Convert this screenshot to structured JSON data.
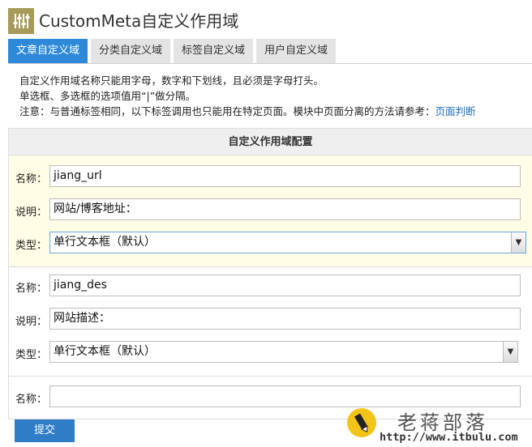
{
  "header": {
    "title": "CustomMeta自定义作用域",
    "logo_icon": "meta-settings-icon",
    "logo_color": "#a59a5a"
  },
  "tabs": [
    {
      "label": "文章自定义域",
      "active": true
    },
    {
      "label": "分类自定义域",
      "active": false
    },
    {
      "label": "标签自定义域",
      "active": false
    },
    {
      "label": "用户自定义域",
      "active": false
    }
  ],
  "notes": {
    "line1": "自定义作用域名称只能用字母，数字和下划线，且必须是字母打头。",
    "line2": "单选框、多选框的选项值用“|”做分隔。",
    "line3_prefix": "注意：与普通标签相同，以下标签调用也只能用在特定页面。模块中页面分离的方法请参考：",
    "line3_link": "页面判断"
  },
  "panel": {
    "title": "自定义作用域配置",
    "labels": {
      "name": "名称：",
      "desc": "说明：",
      "type": "类型："
    },
    "groups": [
      {
        "name": "jiang_url",
        "desc": "网站/博客地址：",
        "type": "单行文本框（默认）"
      },
      {
        "name": "jiang_des",
        "desc": "网站描述：",
        "type": "单行文本框（默认）"
      },
      {
        "name": ""
      }
    ]
  },
  "submit_label": "提交",
  "watermark": {
    "title": "老蒋部落",
    "url": "http://www.itbulu.com"
  },
  "colors": {
    "accent": "#2e8ad8",
    "button": "#2e7dc6",
    "highlight": "#fffde6",
    "link": "#1e6fbf"
  }
}
